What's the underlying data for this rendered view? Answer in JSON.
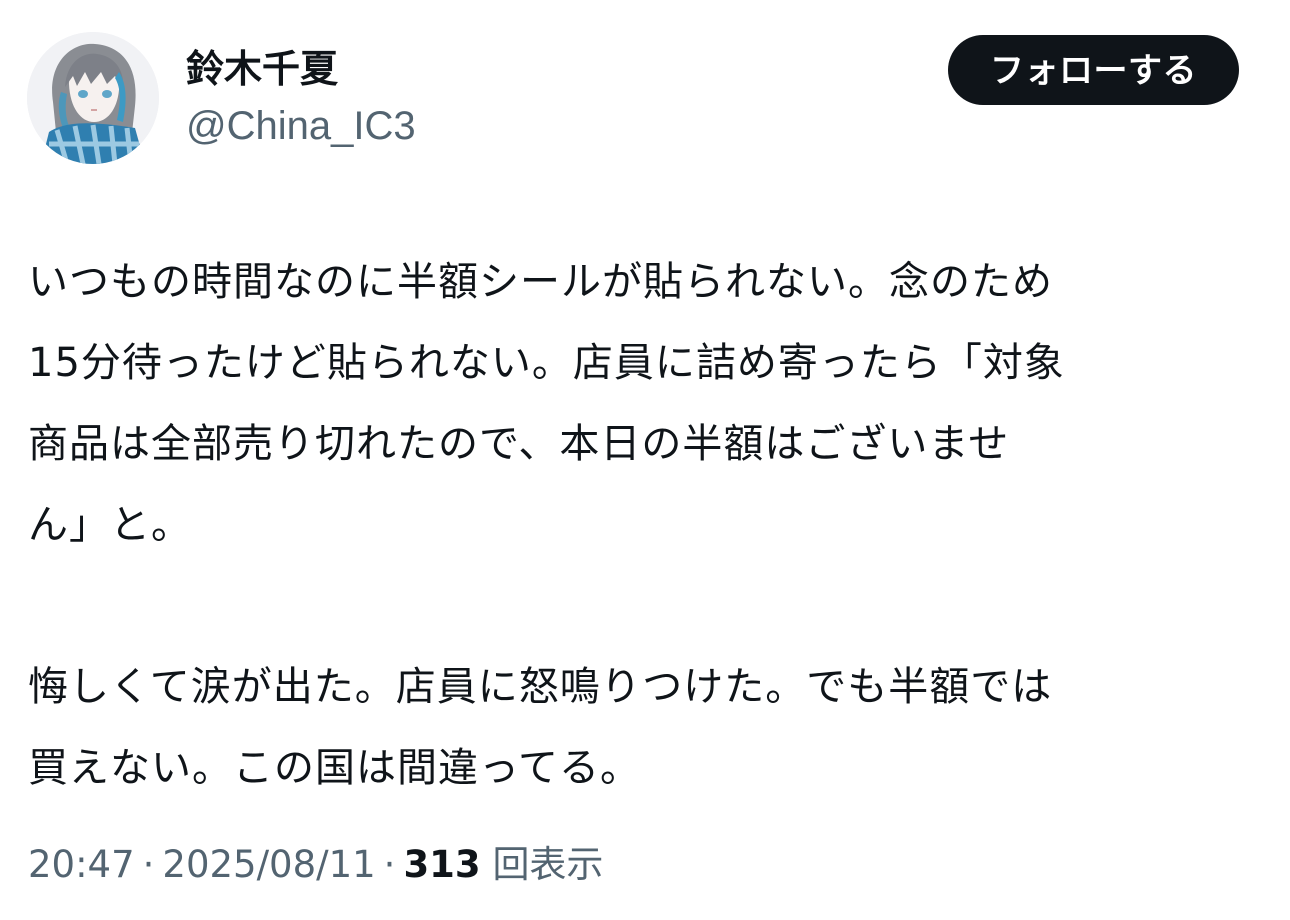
{
  "profile": {
    "display_name": "鈴木千夏",
    "handle": "@China_IC3",
    "follow_label": "フォローする"
  },
  "tweet": {
    "paragraph1": [
      "いつもの時間なのに半額シールが貼られない。念のため",
      "15分待ったけど貼られない。店員に詰め寄ったら「対象",
      "商品は全部売り切れたので、本日の半額はございませ",
      "ん」と。"
    ],
    "paragraph2": [
      "悔しくて涙が出た。店員に怒鳴りつけた。でも半額では",
      "買えない。この国は間違ってる。"
    ]
  },
  "meta": {
    "time": "20:47",
    "separator": "·",
    "date": "2025/08/11",
    "views_count": "313",
    "views_label": "回表示"
  },
  "colors": {
    "text": "#0f1419",
    "secondary": "#536471",
    "button_bg": "#0f1419",
    "avatar_accent": "#3d9ac4"
  },
  "icons": {
    "avatar": "profile-avatar-illustration"
  }
}
